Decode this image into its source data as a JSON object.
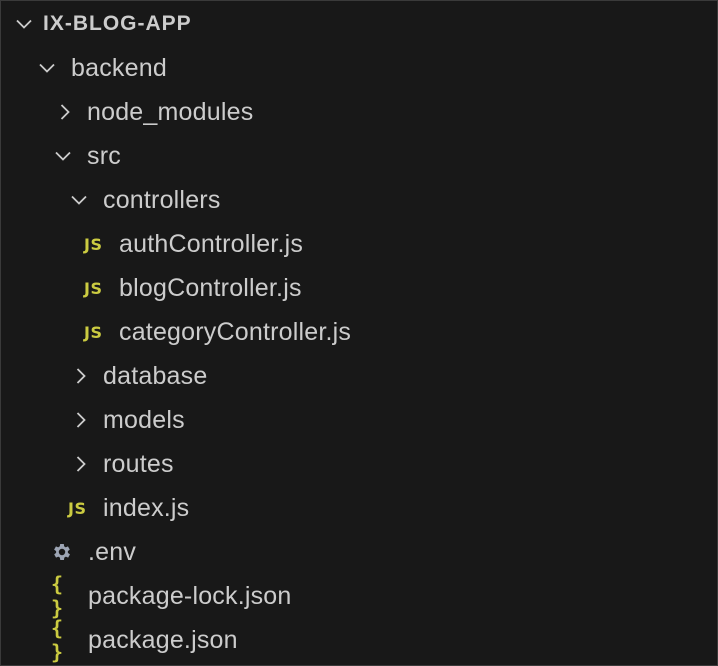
{
  "explorer": {
    "root": {
      "label": "IX-BLOG-APP",
      "expanded": true
    },
    "items": [
      {
        "label": "backend",
        "type": "folder",
        "expanded": true
      },
      {
        "label": "node_modules",
        "type": "folder",
        "expanded": false
      },
      {
        "label": "src",
        "type": "folder",
        "expanded": true
      },
      {
        "label": "controllers",
        "type": "folder",
        "expanded": true
      },
      {
        "label": "authController.js",
        "type": "file",
        "icon_text": "JS"
      },
      {
        "label": "blogController.js",
        "type": "file",
        "icon_text": "JS"
      },
      {
        "label": "categoryController.js",
        "type": "file",
        "icon_text": "JS"
      },
      {
        "label": "database",
        "type": "folder",
        "expanded": false
      },
      {
        "label": "models",
        "type": "folder",
        "expanded": false
      },
      {
        "label": "routes",
        "type": "folder",
        "expanded": false
      },
      {
        "label": "index.js",
        "type": "file",
        "icon_text": "JS"
      },
      {
        "label": ".env",
        "type": "file",
        "icon": "gear-icon"
      },
      {
        "label": "package-lock.json",
        "type": "file",
        "icon_text": "{ }"
      },
      {
        "label": "package.json",
        "type": "file",
        "icon_text": "{ }"
      }
    ]
  },
  "colors": {
    "background": "#181818",
    "text": "#cccccc",
    "file_icon": "#cbcb41",
    "gear_icon": "#9da5b4"
  }
}
